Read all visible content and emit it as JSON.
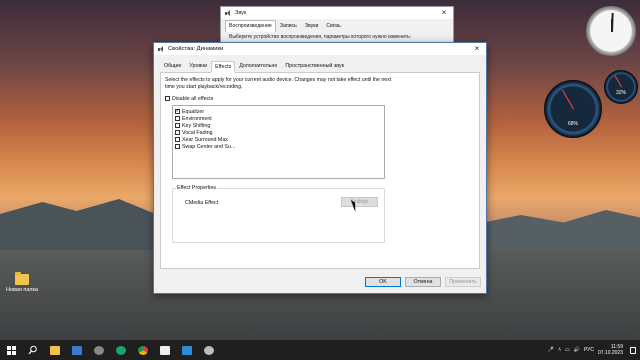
{
  "desktop": {
    "folder_label": "Новая папка",
    "gauge_cpu": "68%",
    "gauge_mem": "32%"
  },
  "background_window": {
    "title": "Звук",
    "tabs": [
      "Воспроизведение",
      "Запись",
      "Звуки",
      "Связь"
    ],
    "description": "Выберите устройство воспроизведения, параметры которого нужно изменить:"
  },
  "dialog": {
    "title": "Свойства: Динамики",
    "tabs": [
      "Общие",
      "Уровни",
      "Effects",
      "Дополнительно",
      "Пространственный звук"
    ],
    "active_tab": "Effects",
    "intro": "Select the effects to apply for your current audio device. Changes may not take effect until the next time you start playback/recording.",
    "disable_all_label": "Disable all effects",
    "effects": [
      {
        "label": "Equalizer",
        "checked": true
      },
      {
        "label": "Environment",
        "checked": false
      },
      {
        "label": "Key Shifting",
        "checked": false
      },
      {
        "label": "Vocal Fading",
        "checked": false
      },
      {
        "label": "Xear Surround Max",
        "checked": false
      },
      {
        "label": "Swap Center and Su...",
        "checked": false
      }
    ],
    "effect_properties_label": "Effect Properties",
    "effect_name": "CMedia Effect",
    "settings_label": "Settings",
    "ok_label": "OK",
    "cancel_label": "Отмена",
    "apply_label": "Применить"
  },
  "taskbar": {
    "language": "РУС",
    "time": "11:59",
    "date": "07.10.2023"
  },
  "colors": {
    "accent": "#0078d7",
    "taskbar": "#1f1f1f",
    "dialog_bg": "#f0f0f0"
  }
}
